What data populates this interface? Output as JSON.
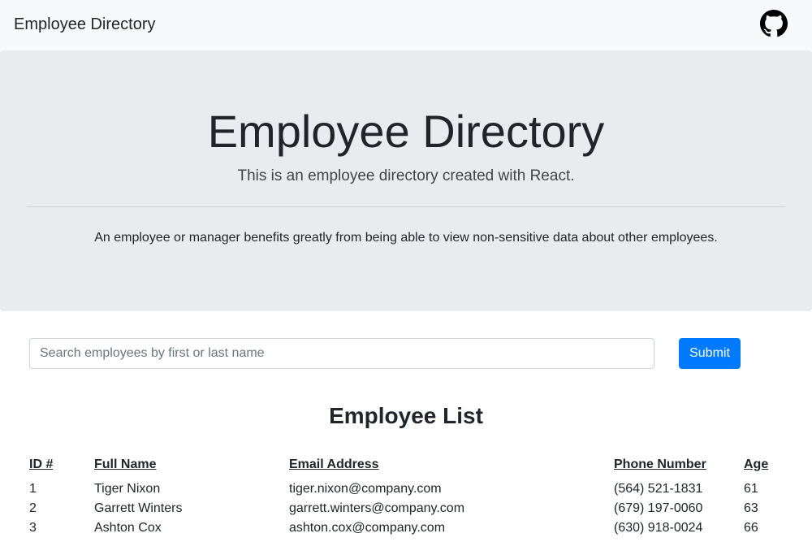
{
  "navbar": {
    "brand": "Employee Directory",
    "github_icon": "github-icon"
  },
  "jumbotron": {
    "title": "Employee Directory",
    "lead": "This is an employee directory created with React.",
    "description": "An employee or manager benefits greatly from being able to view non-sensitive data about other employees."
  },
  "search": {
    "placeholder": "Search employees by first or last name",
    "value": "",
    "submit_label": "Submit",
    "submit_color": "#007bff"
  },
  "list": {
    "title": "Employee List",
    "columns": [
      "ID #",
      "Full Name",
      "Email Address",
      "Phone Number",
      "Age"
    ],
    "rows": [
      [
        "1",
        "Tiger Nixon",
        "tiger.nixon@company.com",
        "(564) 521-1831",
        "61"
      ],
      [
        "2",
        "Garrett Winters",
        "garrett.winters@company.com",
        "(679) 197-0060",
        "63"
      ],
      [
        "3",
        "Ashton Cox",
        "ashton.cox@company.com",
        "(630) 918-0024",
        "66"
      ]
    ]
  }
}
